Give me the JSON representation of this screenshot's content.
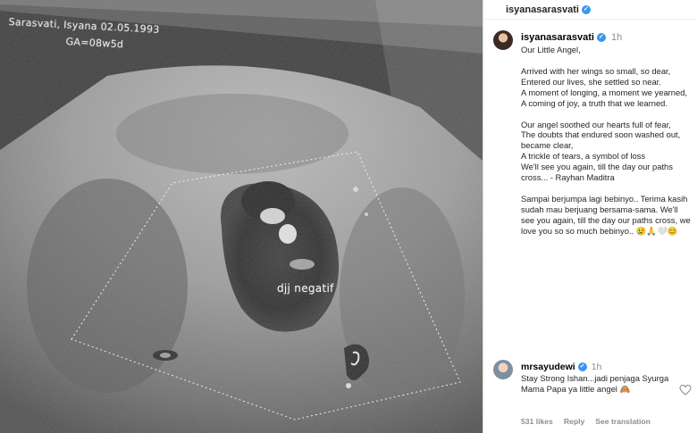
{
  "photo": {
    "header_text": "Sarasvati, Isyana  02.05.1993",
    "ga_text": "GA=08w5d",
    "fetal_label": "djj negatif"
  },
  "post": {
    "username": "isyanasarasvati",
    "time": "1h",
    "caption_paragraphs": [
      "Our Little Angel,",
      "Arrived with her wings so small, so dear,\nEntered our lives, she settled so near.\nA moment of longing, a moment we yearned,\nA coming of joy, a truth that we learned.",
      "Our angel soothed our hearts full of fear,\nThe doubts that endured soon washed out, became clear,\nA trickle of tears, a symbol of loss\nWe'll see you again, till the day our paths cross... - Rayhan Maditra",
      "Sampai berjumpa lagi bebinyo.. Terima kasih sudah mau berjuang bersama-sama. We'll see you again, till the day our paths cross, we love you so so much bebinyo.. 😢🙏🤍😊"
    ]
  },
  "comment": {
    "username": "mrsayudewi",
    "time": "1h",
    "text": "Stay Strong Ishan...jadi penjaga Syurga Mama Papa ya little angel 🙈",
    "likes": "531 likes",
    "reply": "Reply",
    "see_translation": "See translation"
  },
  "colors": {
    "verified": "#3897f0",
    "meta_grey": "#8e8e8e"
  },
  "icons": [
    "verified-icon",
    "heart-icon"
  ]
}
